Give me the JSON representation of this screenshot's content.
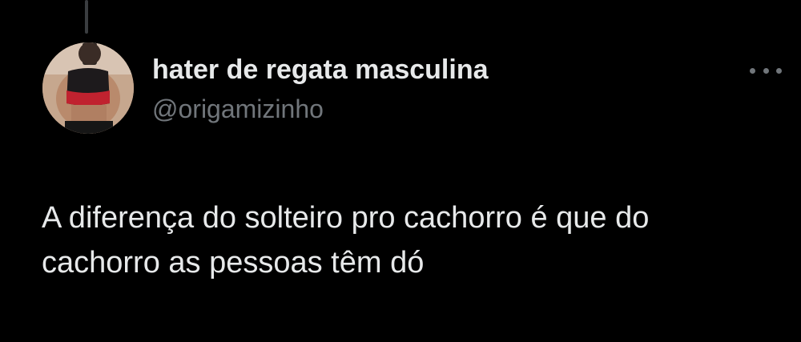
{
  "tweet": {
    "author": {
      "display_name": "hater de regata masculina",
      "handle": "@origamizinho",
      "avatar_icon": "profile-photo"
    },
    "more_icon": "more-horizontal-icon",
    "text_lines": [
      "A diferença do solteiro pro cachorro é que do",
      "cachorro as pessoas têm dó"
    ]
  },
  "colors": {
    "background": "#000000",
    "primary_text": "#e7e9ea",
    "secondary_text": "#71767b"
  }
}
